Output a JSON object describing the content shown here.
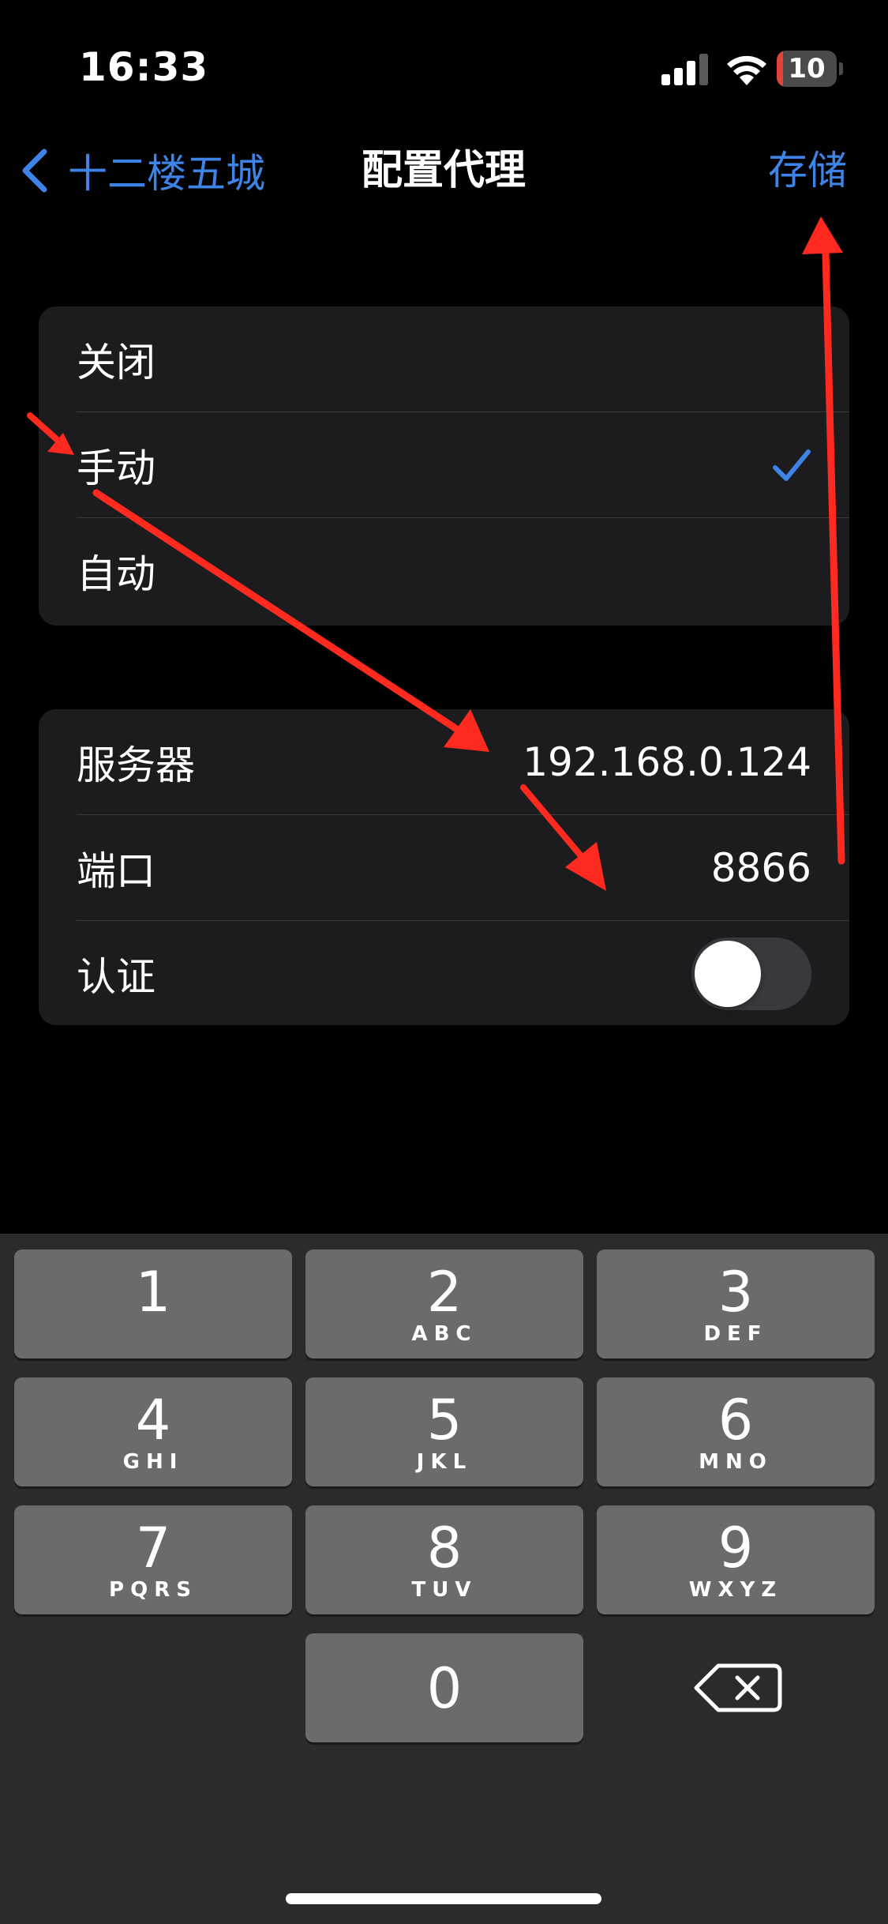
{
  "status_bar": {
    "time": "16:33",
    "battery_level": "10",
    "battery_percent": 10,
    "icons": [
      "cellular-signal-icon",
      "wifi-icon",
      "battery-icon"
    ]
  },
  "nav": {
    "back_label": "十二楼五城",
    "title": "配置代理",
    "save_label": "存储"
  },
  "proxy_modes": {
    "items": [
      {
        "label": "关闭",
        "selected": false
      },
      {
        "label": "手动",
        "selected": true
      },
      {
        "label": "自动",
        "selected": false
      }
    ]
  },
  "proxy_config": {
    "server_label": "服务器",
    "server_value": "192.168.0.124",
    "port_label": "端口",
    "port_value": "8866",
    "auth_label": "认证",
    "auth_enabled": false
  },
  "keypad": {
    "keys": [
      {
        "digit": "1",
        "letters": ""
      },
      {
        "digit": "2",
        "letters": "ABC"
      },
      {
        "digit": "3",
        "letters": "DEF"
      },
      {
        "digit": "4",
        "letters": "GHI"
      },
      {
        "digit": "5",
        "letters": "JKL"
      },
      {
        "digit": "6",
        "letters": "MNO"
      },
      {
        "digit": "7",
        "letters": "PQRS"
      },
      {
        "digit": "8",
        "letters": "TUV"
      },
      {
        "digit": "9",
        "letters": "WXYZ"
      },
      {
        "digit": "0",
        "letters": ""
      }
    ]
  },
  "colors": {
    "accent": "#3e83e6",
    "background": "#000000",
    "group_background": "#1c1c1e",
    "keypad_background": "#2b2b2b",
    "key_background": "#6b6b6b",
    "annotation_arrow": "#ff2a1f",
    "battery_low": "#e0433a"
  }
}
